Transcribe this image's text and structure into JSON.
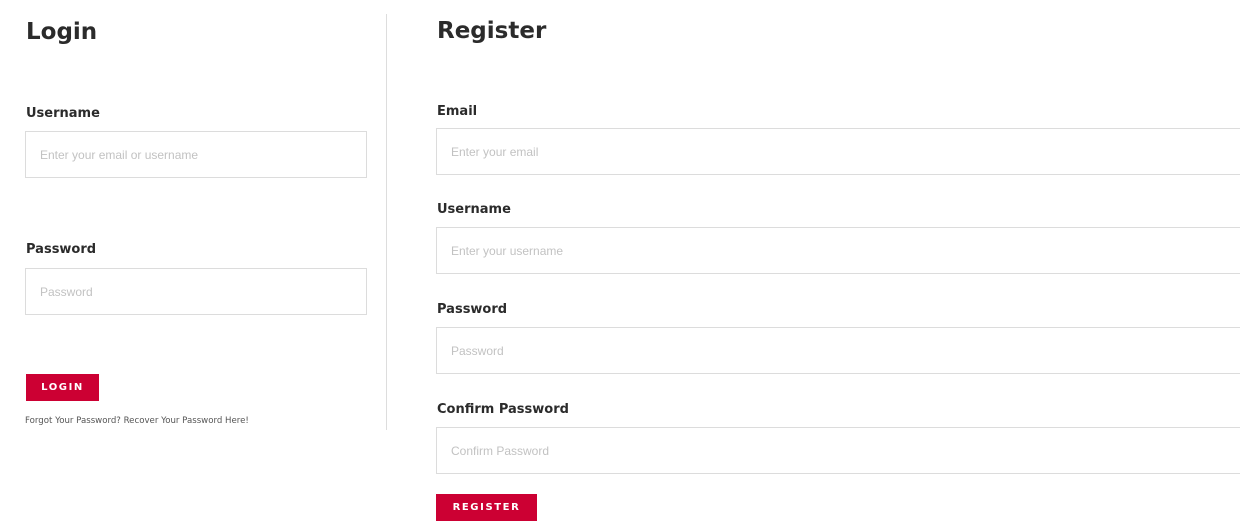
{
  "login": {
    "title": "Login",
    "username_label": "Username",
    "username_placeholder": "Enter your email or username",
    "password_label": "Password",
    "password_placeholder": "Password",
    "button_label": "LOGIN",
    "forgot_text": "Forgot Your Password? Recover Your Password Here!"
  },
  "register": {
    "title": "Register",
    "email_label": "Email",
    "email_placeholder": "Enter your email",
    "username_label": "Username",
    "username_placeholder": "Enter your username",
    "password_label": "Password",
    "password_placeholder": "Password",
    "confirm_label": "Confirm Password",
    "confirm_placeholder": "Confirm Password",
    "button_label": "REGISTER"
  },
  "colors": {
    "accent": "#cc0033",
    "border": "#dcdcdc",
    "text": "#2b2b2b",
    "placeholder": "#c2c2c2"
  }
}
